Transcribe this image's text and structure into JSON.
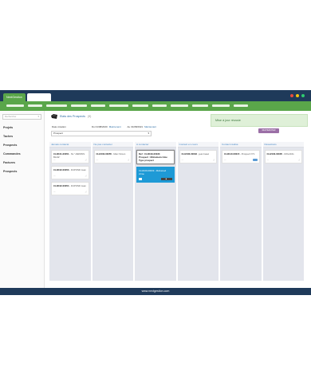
{
  "app": {
    "tab_label": "NextGestion",
    "window_dots": [
      "#e74c3c",
      "#f1c40f",
      "#2ecc71"
    ]
  },
  "sidebar": {
    "search_placeholder": "Rechercher",
    "items": [
      {
        "label": "Projets"
      },
      {
        "label": "Taches"
      },
      {
        "label": "Prospects"
      },
      {
        "label": "Commandes"
      },
      {
        "label": "Factures"
      },
      {
        "label": "Prospects"
      }
    ]
  },
  "page": {
    "title": "Etats des Prospects",
    "count": "(9)"
  },
  "filter": {
    "label": "Date création",
    "from": "Du 01/08/2020",
    "from_link": "Maintenant",
    "to": "Au 31/08/2021",
    "to_link": "Maintenant",
    "type_value": "Prospect"
  },
  "toolbar": {
    "action_label": "RECHERCHER"
  },
  "toast": {
    "message": "Mise à jour réussie"
  },
  "columns": [
    {
      "title": "Jamais contacté",
      "cards": [
        {
          "ref": "CLI2101-00051",
          "text": " - NL \"JARDINS BLUE\"",
          "foot": "—"
        },
        {
          "ref": "CLI2102-00053",
          "text": " - DUPOND Jean",
          "foot": "—"
        },
        {
          "ref": "CLI2102-00054",
          "text": " - DUPOND Jean",
          "foot": "—"
        }
      ]
    },
    {
      "title": "Ne pas contacter",
      "cards": [
        {
          "ref": "CLI2103-00055",
          "text": " - Marc Simon",
          "foot": "—"
        }
      ]
    },
    {
      "title": "A contacter",
      "cards": [
        {
          "ref": "Ref : CLI2109-00033",
          "text": "Prospect : Mohamed.crime",
          "text2": "Type prospect",
          "selected": true
        },
        {
          "ref": "CLI2109-00033 - Mohamed crime",
          "blue": true,
          "button": "■"
        }
      ]
    },
    {
      "title": "Contact en cours",
      "cards": [
        {
          "ref": "CLI2106-00033",
          "text": " - jean Isaac",
          "foot": "—"
        }
      ]
    },
    {
      "title": "Contact réalisé",
      "cards": [
        {
          "ref": "CLI2110-00015",
          "text": " - Prospect N°1",
          "foot": "—",
          "badge": true
        }
      ]
    },
    {
      "title": "Désactivés",
      "cards": [
        {
          "ref": "CLI2103-00005",
          "text": " - MOLANG",
          "foot": "—"
        }
      ]
    }
  ],
  "footer": {
    "url": "www.nextgestion.com"
  }
}
